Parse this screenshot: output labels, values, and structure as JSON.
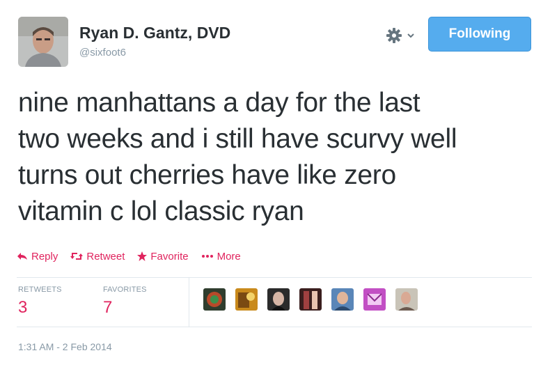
{
  "user": {
    "fullname": "Ryan D. Gantz, DVD",
    "screen_name": "@sixfoot6",
    "avatar_icon": "avatar-photo"
  },
  "header": {
    "gear_icon": "gear-icon",
    "follow_label": "Following"
  },
  "tweet": {
    "lines": [
      "nine manhattans a day for the last",
      "two weeks and i still have scurvy well",
      "turns out cherries have like zero",
      "vitamin c lol classic ryan"
    ]
  },
  "actions": {
    "reply": "Reply",
    "retweet": "Retweet",
    "favorite": "Favorite",
    "more": "More"
  },
  "stats": {
    "retweets_label": "RETWEETS",
    "retweets_count": "3",
    "favorites_label": "FAVORITES",
    "favorites_count": "7"
  },
  "timestamp": "1:31 AM - 2 Feb 2014",
  "colors": {
    "accent": "#e0245e",
    "follow_bg": "#55acee",
    "muted": "#8899a6"
  }
}
